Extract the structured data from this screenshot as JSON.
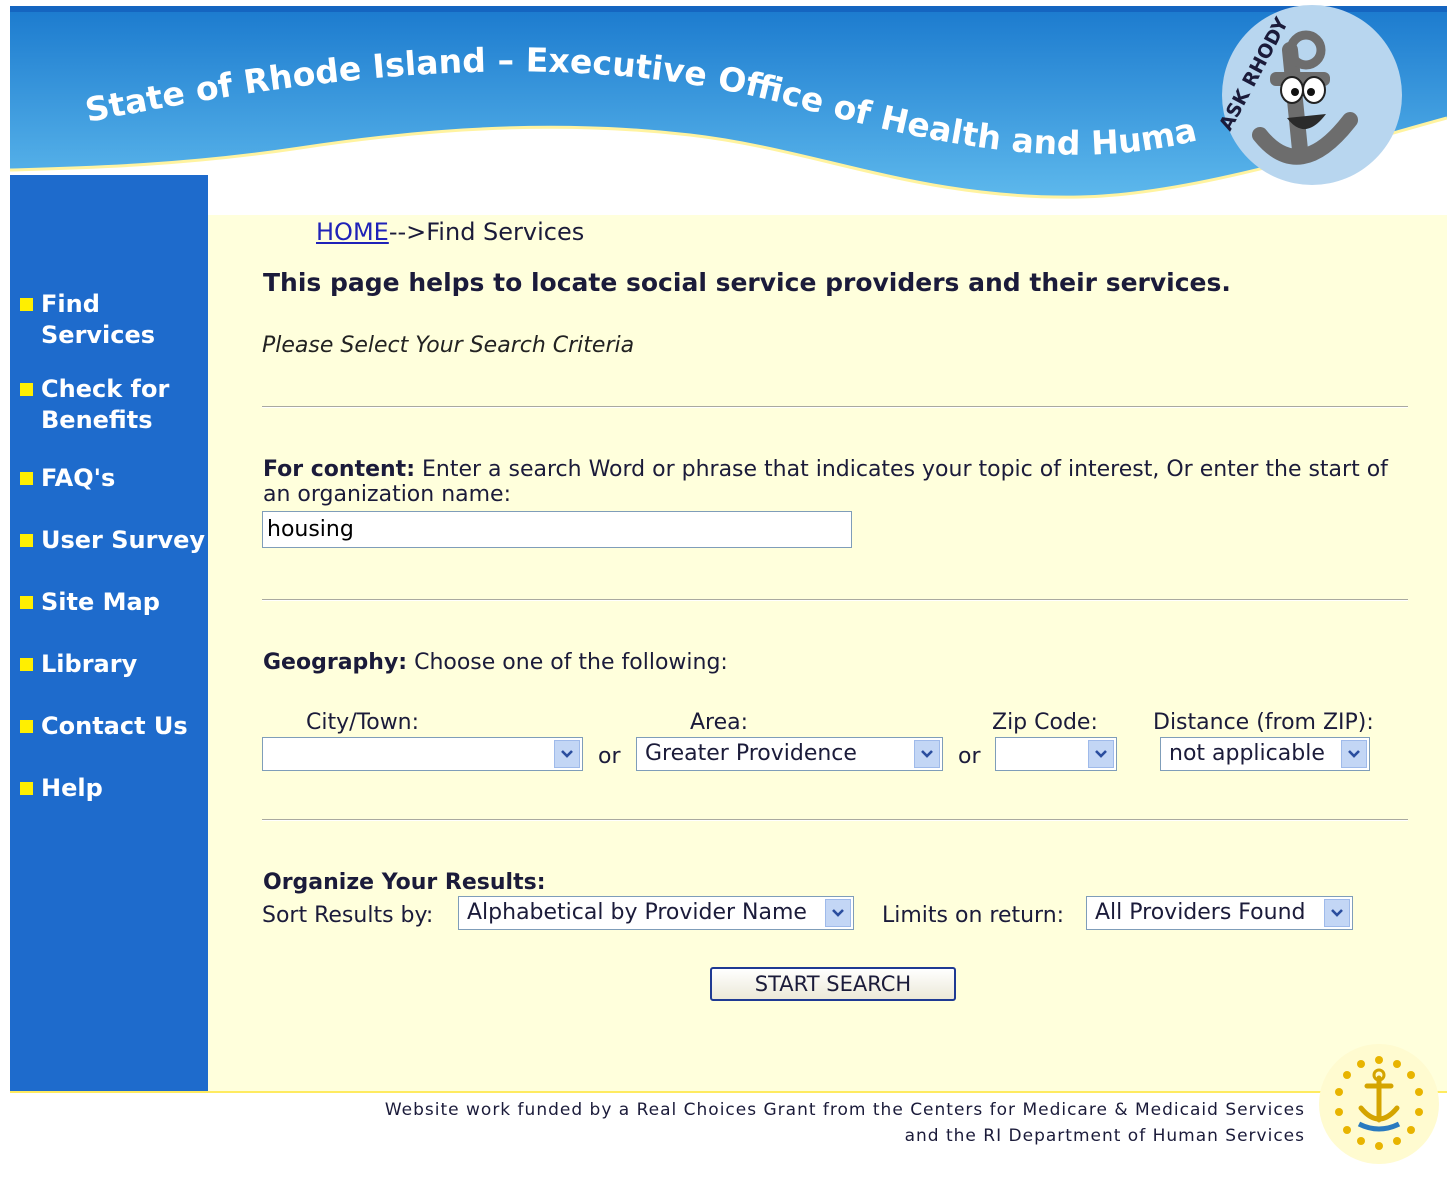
{
  "header": {
    "title": "State of Rhode Island – Executive Office of Health and Human Services",
    "mascot_caption": "ASK RHODY"
  },
  "sidebar": {
    "items": [
      {
        "lines": [
          "Find",
          "Services"
        ]
      },
      {
        "lines": [
          "Check for",
          "Benefits"
        ]
      },
      {
        "lines": [
          "FAQ's"
        ]
      },
      {
        "lines": [
          "User Survey"
        ]
      },
      {
        "lines": [
          "Site Map"
        ]
      },
      {
        "lines": [
          "Library"
        ]
      },
      {
        "lines": [
          "Contact Us"
        ]
      },
      {
        "lines": [
          "Help"
        ]
      }
    ]
  },
  "breadcrumb": {
    "home": "HOME",
    "separator": "-->",
    "current": "Find Services"
  },
  "main": {
    "intro": "This page helps to locate social service providers and their services.",
    "criteria": "Please Select Your Search Criteria",
    "content": {
      "label": "For content:",
      "instructions": " Enter a search Word or phrase that indicates your topic of interest, Or enter the start of an organization name:",
      "value": "housing"
    },
    "geography": {
      "label": "Geography:",
      "instructions": " Choose one of the following:",
      "city_label": "City/Town:",
      "city_value": "",
      "or_1": "or",
      "area_label": "Area:",
      "area_value": "Greater Providence",
      "or_2": "or",
      "zip_label": "Zip Code:",
      "zip_value": "",
      "distance_label": "Distance (from ZIP):",
      "distance_value": "not applicable"
    },
    "organize": {
      "heading": "Organize Your Results:",
      "sort_label": "Sort Results by:",
      "sort_value": "Alphabetical by Provider Name",
      "limit_label": "Limits on return:",
      "limit_value": "All Providers Found"
    },
    "start_button": "START SEARCH"
  },
  "footer": {
    "line1": "Website work funded by a Real Choices Grant from the Centers for Medicare & Medicaid Services",
    "line2": "and the RI Department of Human Services"
  },
  "colors": {
    "sidebar_blue": "#1e6bcc",
    "header_blue": "#2d8fd8",
    "content_bg": "#ffffdc",
    "bullet_yellow": "#ffef00",
    "link": "#1f22b8"
  },
  "icons": [
    "ask-rhody-anchor-mascot-icon",
    "rhode-island-seal-icon",
    "chevron-down-icon"
  ]
}
